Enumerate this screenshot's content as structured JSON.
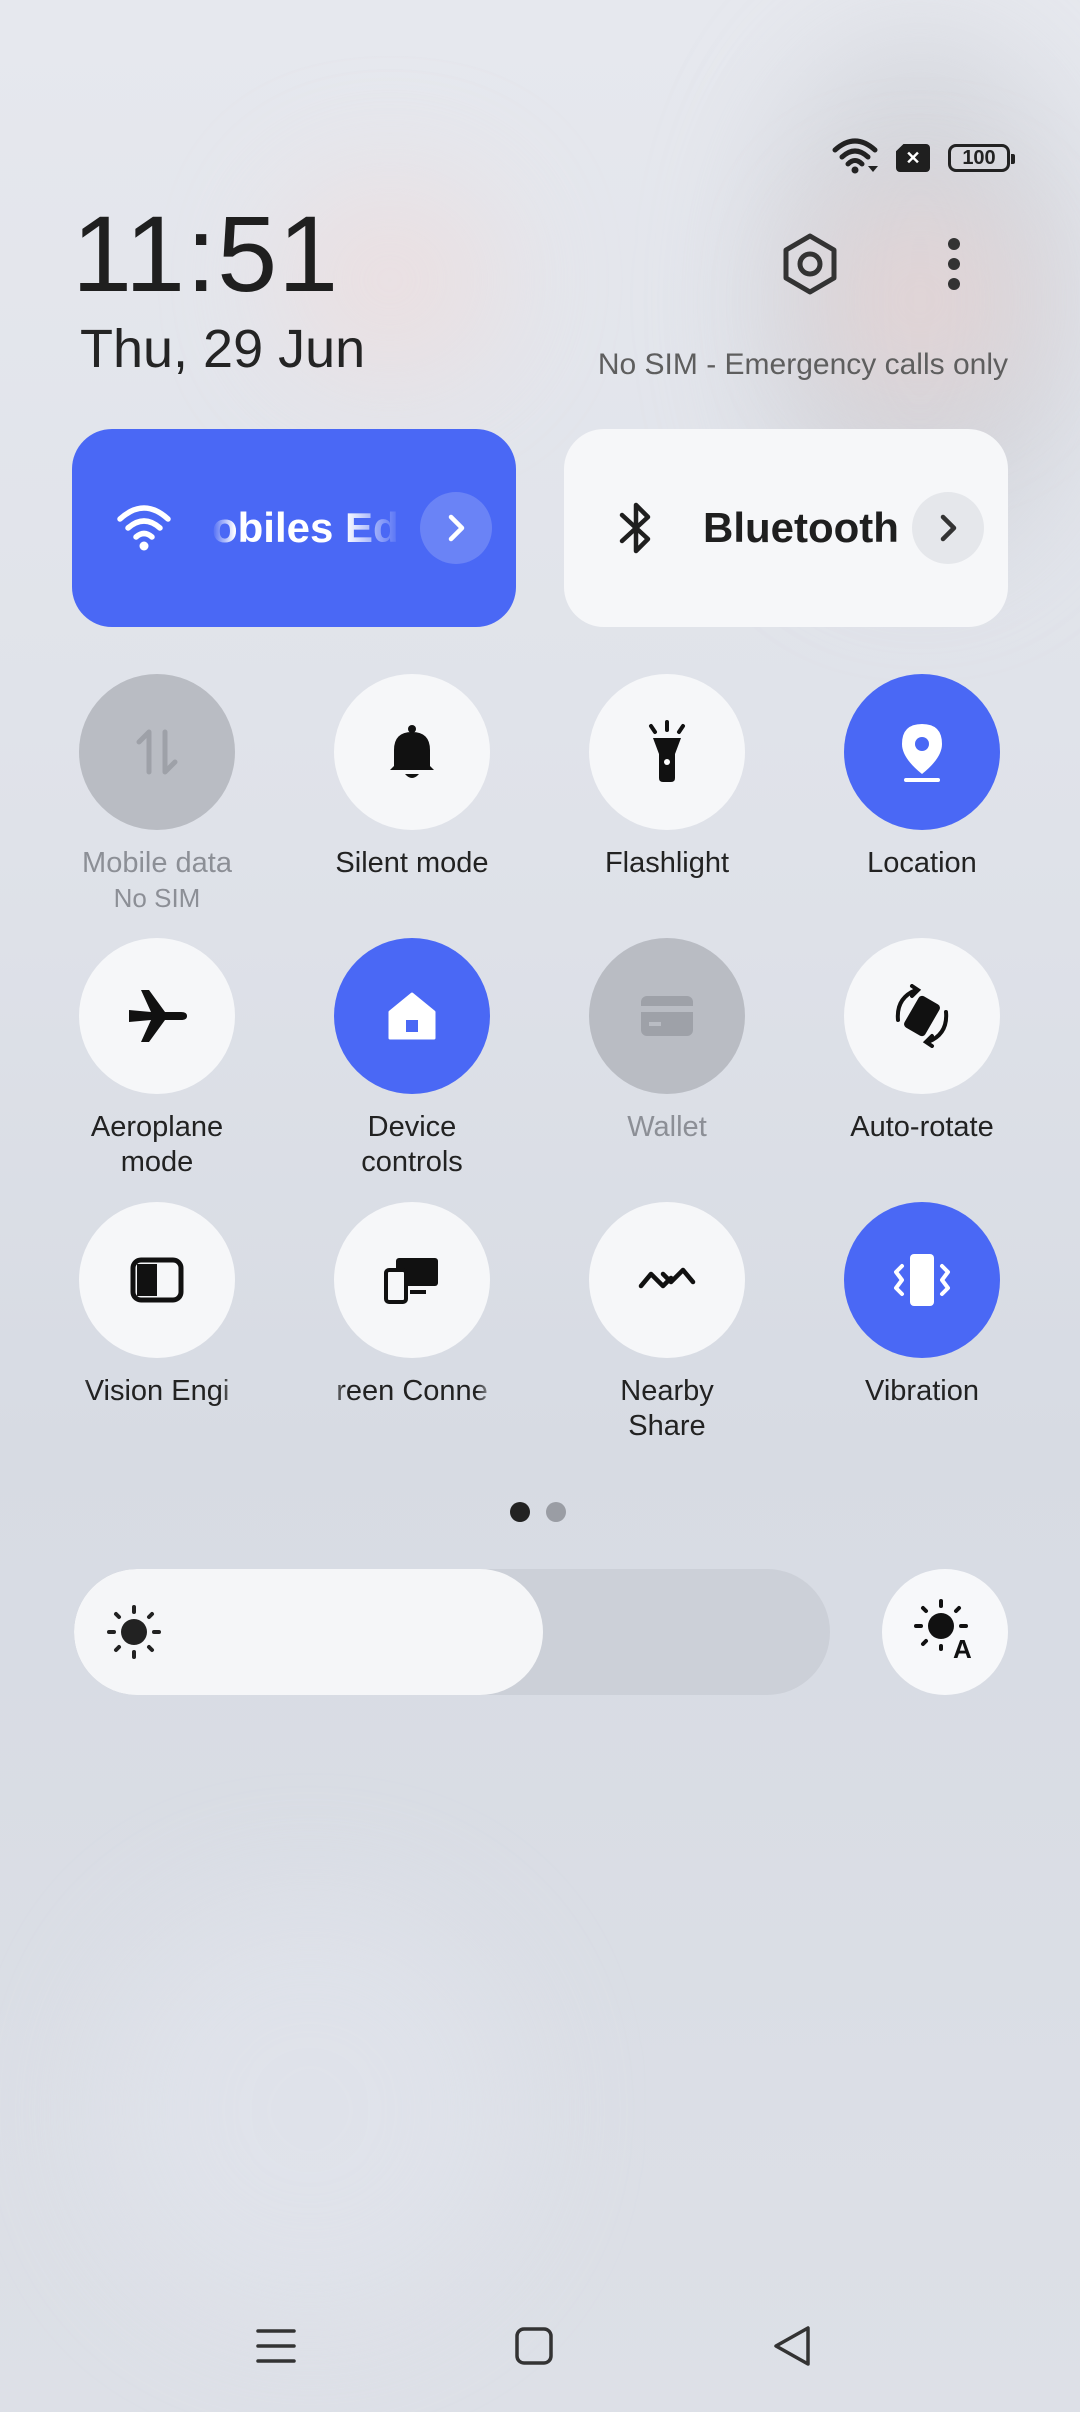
{
  "status_bar": {
    "icons": [
      "wifi-icon",
      "no-sim-icon",
      "battery-icon"
    ],
    "battery_level": "100"
  },
  "header": {
    "time": "11:51",
    "date": "Thu, 29 Jun",
    "sim_status": "No SIM - Emergency calls only",
    "icons": [
      "settings-icon",
      "more-options-icon"
    ]
  },
  "big_tiles": {
    "wifi": {
      "label": "obiles Edit",
      "icon": "wifi-icon",
      "state": "on"
    },
    "bluetooth": {
      "label": "Bluetooth",
      "icon": "bluetooth-icon",
      "state": "off"
    }
  },
  "toggles": [
    {
      "label": "Mobile data",
      "sub": "No SIM",
      "icon": "mobile-data-icon",
      "state": "disabled"
    },
    {
      "label": "Silent mode",
      "icon": "bell-icon",
      "state": "off"
    },
    {
      "label": "Flashlight",
      "icon": "flashlight-icon",
      "state": "off"
    },
    {
      "label": "Location",
      "icon": "location-icon",
      "state": "on"
    },
    {
      "label": "Aeroplane mode",
      "icon": "airplane-icon",
      "state": "off"
    },
    {
      "label": "Device controls",
      "icon": "home-icon",
      "state": "on"
    },
    {
      "label": "Wallet",
      "icon": "wallet-icon",
      "state": "disabled"
    },
    {
      "label": "Auto-rotate",
      "icon": "auto-rotate-icon",
      "state": "off"
    },
    {
      "label": "Vision Engi",
      "icon": "vision-engine-icon",
      "state": "off"
    },
    {
      "label": "reen Conne",
      "icon": "screen-connect-icon",
      "state": "off"
    },
    {
      "label": "Nearby Share",
      "icon": "nearby-share-icon",
      "state": "off"
    },
    {
      "label": "Vibration",
      "icon": "vibration-icon",
      "state": "on"
    }
  ],
  "page_indicator": {
    "current": 1,
    "total": 2
  },
  "brightness": {
    "level": 0.62,
    "icons": [
      "brightness-icon",
      "auto-brightness-icon"
    ]
  },
  "nav_bar": {
    "icons": [
      "menu-icon",
      "home-square-icon",
      "back-icon"
    ]
  },
  "colors": {
    "accent": "#4a68f5",
    "tile_off": "#f6f7f9",
    "tile_disabled": "#b9bcc3"
  }
}
